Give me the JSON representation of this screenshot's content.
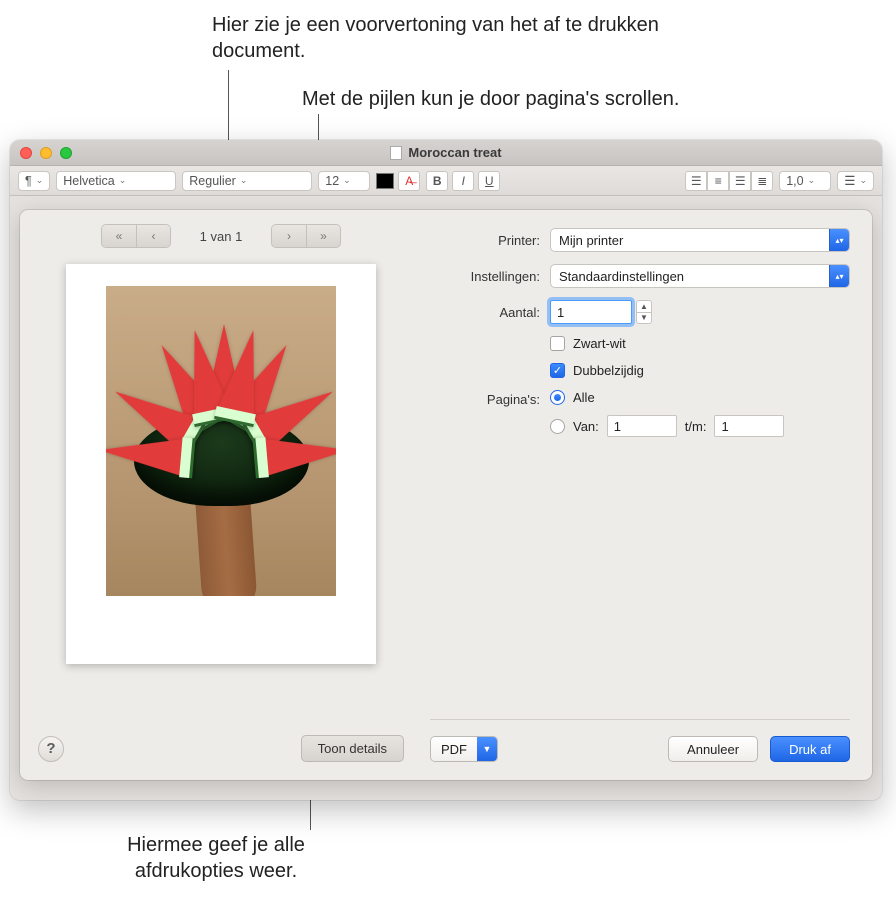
{
  "annotations": {
    "preview_hint": "Hier zie je een voorvertoning van het af te drukken document.",
    "arrows_hint": "Met de pijlen kun je door pagina's scrollen.",
    "details_hint": "Hiermee geef je alle afdrukopties weer."
  },
  "window": {
    "title": "Moroccan treat"
  },
  "toolbar": {
    "font_family": "Helvetica",
    "font_style": "Regulier",
    "font_size": "12",
    "bold": "B",
    "italic": "I",
    "underline": "U",
    "line_spacing": "1,0"
  },
  "dialog": {
    "page_indicator": "1 van 1",
    "labels": {
      "printer": "Printer:",
      "presets": "Instellingen:",
      "copies": "Aantal:",
      "bw": "Zwart-wit",
      "duplex": "Dubbelzijdig",
      "pages": "Pagina's:",
      "all": "Alle",
      "from": "Van:",
      "to": "t/m:"
    },
    "values": {
      "printer": "Mijn printer",
      "presets": "Standaardinstellingen",
      "copies": "1",
      "bw_checked": false,
      "duplex_checked": true,
      "pages_mode": "all",
      "from": "1",
      "to": "1"
    },
    "buttons": {
      "help": "?",
      "show_details": "Toon details",
      "pdf": "PDF",
      "cancel": "Annuleer",
      "print": "Druk af"
    }
  }
}
